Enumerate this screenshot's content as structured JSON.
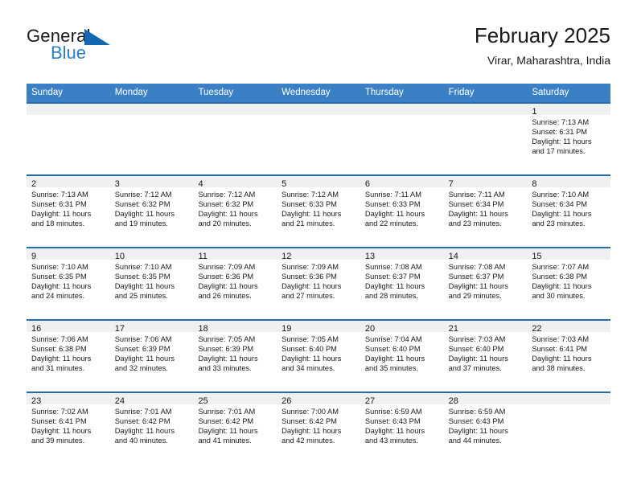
{
  "brand": {
    "name_part1": "General",
    "name_part2": "Blue",
    "logo_icon": "triangle-icon",
    "accent_color": "#2a7fcb"
  },
  "header": {
    "title": "February 2025",
    "subtitle": "Virar, Maharashtra, India"
  },
  "colors": {
    "header_blue": "#3b80c4",
    "row_border_blue": "#1f6eb5",
    "daynum_band": "#f0f0f0",
    "text": "#1a1a1a"
  },
  "weekdays": [
    "Sunday",
    "Monday",
    "Tuesday",
    "Wednesday",
    "Thursday",
    "Friday",
    "Saturday"
  ],
  "weeks": [
    [
      {
        "day": "",
        "sunrise": "",
        "sunset": "",
        "daylight1": "",
        "daylight2": ""
      },
      {
        "day": "",
        "sunrise": "",
        "sunset": "",
        "daylight1": "",
        "daylight2": ""
      },
      {
        "day": "",
        "sunrise": "",
        "sunset": "",
        "daylight1": "",
        "daylight2": ""
      },
      {
        "day": "",
        "sunrise": "",
        "sunset": "",
        "daylight1": "",
        "daylight2": ""
      },
      {
        "day": "",
        "sunrise": "",
        "sunset": "",
        "daylight1": "",
        "daylight2": ""
      },
      {
        "day": "",
        "sunrise": "",
        "sunset": "",
        "daylight1": "",
        "daylight2": ""
      },
      {
        "day": "1",
        "sunrise": "Sunrise: 7:13 AM",
        "sunset": "Sunset: 6:31 PM",
        "daylight1": "Daylight: 11 hours",
        "daylight2": "and 17 minutes."
      }
    ],
    [
      {
        "day": "2",
        "sunrise": "Sunrise: 7:13 AM",
        "sunset": "Sunset: 6:31 PM",
        "daylight1": "Daylight: 11 hours",
        "daylight2": "and 18 minutes."
      },
      {
        "day": "3",
        "sunrise": "Sunrise: 7:12 AM",
        "sunset": "Sunset: 6:32 PM",
        "daylight1": "Daylight: 11 hours",
        "daylight2": "and 19 minutes."
      },
      {
        "day": "4",
        "sunrise": "Sunrise: 7:12 AM",
        "sunset": "Sunset: 6:32 PM",
        "daylight1": "Daylight: 11 hours",
        "daylight2": "and 20 minutes."
      },
      {
        "day": "5",
        "sunrise": "Sunrise: 7:12 AM",
        "sunset": "Sunset: 6:33 PM",
        "daylight1": "Daylight: 11 hours",
        "daylight2": "and 21 minutes."
      },
      {
        "day": "6",
        "sunrise": "Sunrise: 7:11 AM",
        "sunset": "Sunset: 6:33 PM",
        "daylight1": "Daylight: 11 hours",
        "daylight2": "and 22 minutes."
      },
      {
        "day": "7",
        "sunrise": "Sunrise: 7:11 AM",
        "sunset": "Sunset: 6:34 PM",
        "daylight1": "Daylight: 11 hours",
        "daylight2": "and 23 minutes."
      },
      {
        "day": "8",
        "sunrise": "Sunrise: 7:10 AM",
        "sunset": "Sunset: 6:34 PM",
        "daylight1": "Daylight: 11 hours",
        "daylight2": "and 23 minutes."
      }
    ],
    [
      {
        "day": "9",
        "sunrise": "Sunrise: 7:10 AM",
        "sunset": "Sunset: 6:35 PM",
        "daylight1": "Daylight: 11 hours",
        "daylight2": "and 24 minutes."
      },
      {
        "day": "10",
        "sunrise": "Sunrise: 7:10 AM",
        "sunset": "Sunset: 6:35 PM",
        "daylight1": "Daylight: 11 hours",
        "daylight2": "and 25 minutes."
      },
      {
        "day": "11",
        "sunrise": "Sunrise: 7:09 AM",
        "sunset": "Sunset: 6:36 PM",
        "daylight1": "Daylight: 11 hours",
        "daylight2": "and 26 minutes."
      },
      {
        "day": "12",
        "sunrise": "Sunrise: 7:09 AM",
        "sunset": "Sunset: 6:36 PM",
        "daylight1": "Daylight: 11 hours",
        "daylight2": "and 27 minutes."
      },
      {
        "day": "13",
        "sunrise": "Sunrise: 7:08 AM",
        "sunset": "Sunset: 6:37 PM",
        "daylight1": "Daylight: 11 hours",
        "daylight2": "and 28 minutes."
      },
      {
        "day": "14",
        "sunrise": "Sunrise: 7:08 AM",
        "sunset": "Sunset: 6:37 PM",
        "daylight1": "Daylight: 11 hours",
        "daylight2": "and 29 minutes."
      },
      {
        "day": "15",
        "sunrise": "Sunrise: 7:07 AM",
        "sunset": "Sunset: 6:38 PM",
        "daylight1": "Daylight: 11 hours",
        "daylight2": "and 30 minutes."
      }
    ],
    [
      {
        "day": "16",
        "sunrise": "Sunrise: 7:06 AM",
        "sunset": "Sunset: 6:38 PM",
        "daylight1": "Daylight: 11 hours",
        "daylight2": "and 31 minutes."
      },
      {
        "day": "17",
        "sunrise": "Sunrise: 7:06 AM",
        "sunset": "Sunset: 6:39 PM",
        "daylight1": "Daylight: 11 hours",
        "daylight2": "and 32 minutes."
      },
      {
        "day": "18",
        "sunrise": "Sunrise: 7:05 AM",
        "sunset": "Sunset: 6:39 PM",
        "daylight1": "Daylight: 11 hours",
        "daylight2": "and 33 minutes."
      },
      {
        "day": "19",
        "sunrise": "Sunrise: 7:05 AM",
        "sunset": "Sunset: 6:40 PM",
        "daylight1": "Daylight: 11 hours",
        "daylight2": "and 34 minutes."
      },
      {
        "day": "20",
        "sunrise": "Sunrise: 7:04 AM",
        "sunset": "Sunset: 6:40 PM",
        "daylight1": "Daylight: 11 hours",
        "daylight2": "and 35 minutes."
      },
      {
        "day": "21",
        "sunrise": "Sunrise: 7:03 AM",
        "sunset": "Sunset: 6:40 PM",
        "daylight1": "Daylight: 11 hours",
        "daylight2": "and 37 minutes."
      },
      {
        "day": "22",
        "sunrise": "Sunrise: 7:03 AM",
        "sunset": "Sunset: 6:41 PM",
        "daylight1": "Daylight: 11 hours",
        "daylight2": "and 38 minutes."
      }
    ],
    [
      {
        "day": "23",
        "sunrise": "Sunrise: 7:02 AM",
        "sunset": "Sunset: 6:41 PM",
        "daylight1": "Daylight: 11 hours",
        "daylight2": "and 39 minutes."
      },
      {
        "day": "24",
        "sunrise": "Sunrise: 7:01 AM",
        "sunset": "Sunset: 6:42 PM",
        "daylight1": "Daylight: 11 hours",
        "daylight2": "and 40 minutes."
      },
      {
        "day": "25",
        "sunrise": "Sunrise: 7:01 AM",
        "sunset": "Sunset: 6:42 PM",
        "daylight1": "Daylight: 11 hours",
        "daylight2": "and 41 minutes."
      },
      {
        "day": "26",
        "sunrise": "Sunrise: 7:00 AM",
        "sunset": "Sunset: 6:42 PM",
        "daylight1": "Daylight: 11 hours",
        "daylight2": "and 42 minutes."
      },
      {
        "day": "27",
        "sunrise": "Sunrise: 6:59 AM",
        "sunset": "Sunset: 6:43 PM",
        "daylight1": "Daylight: 11 hours",
        "daylight2": "and 43 minutes."
      },
      {
        "day": "28",
        "sunrise": "Sunrise: 6:59 AM",
        "sunset": "Sunset: 6:43 PM",
        "daylight1": "Daylight: 11 hours",
        "daylight2": "and 44 minutes."
      },
      {
        "day": "",
        "sunrise": "",
        "sunset": "",
        "daylight1": "",
        "daylight2": ""
      }
    ]
  ]
}
